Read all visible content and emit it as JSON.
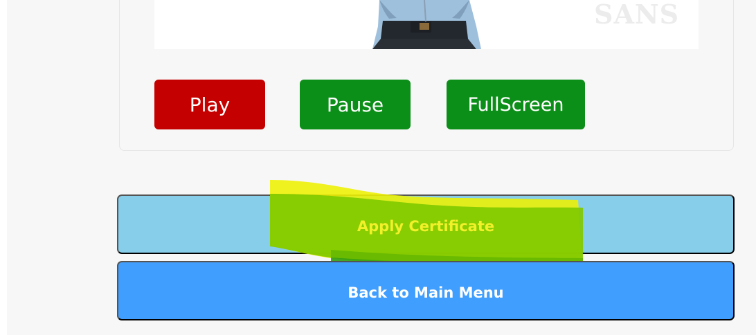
{
  "video_player": {
    "watermark_text": "SANS",
    "controls": {
      "play_label": "Play",
      "pause_label": "Pause",
      "fullscreen_label": "FullScreen"
    },
    "colors": {
      "play": "#c50000",
      "pause": "#0c8f18",
      "fullscreen": "#0c8f18"
    }
  },
  "actions": {
    "apply_certificate_label": "Apply Certificate",
    "back_to_main_menu_label": "Back to Main Menu",
    "colors": {
      "apply_certificate_bg": "#87ceeb",
      "back_to_main_menu_bg": "#409eff",
      "highlight": "#d8ea00"
    }
  }
}
